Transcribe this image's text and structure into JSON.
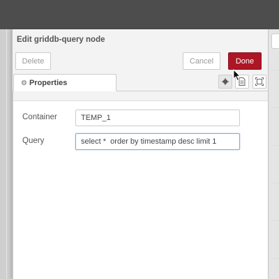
{
  "editor": {
    "title": "Edit griddb-query node",
    "delete_label": "Delete",
    "cancel_label": "Cancel",
    "done_label": "Done"
  },
  "tabs": [
    {
      "label": "Properties",
      "icon": "gear-icon",
      "active": true
    }
  ],
  "tab_icons": [
    "gear-icon",
    "description-icon",
    "appearance-icon"
  ],
  "form": {
    "container": {
      "label": "Container",
      "value": "TEMP_1"
    },
    "query": {
      "label": "Query",
      "value": "select *  order by timestamp desc limit 1"
    }
  },
  "colors": {
    "header_bg": "#4d4d4d",
    "done_button": "#ad1625",
    "focus_border": "#85a9cc"
  }
}
